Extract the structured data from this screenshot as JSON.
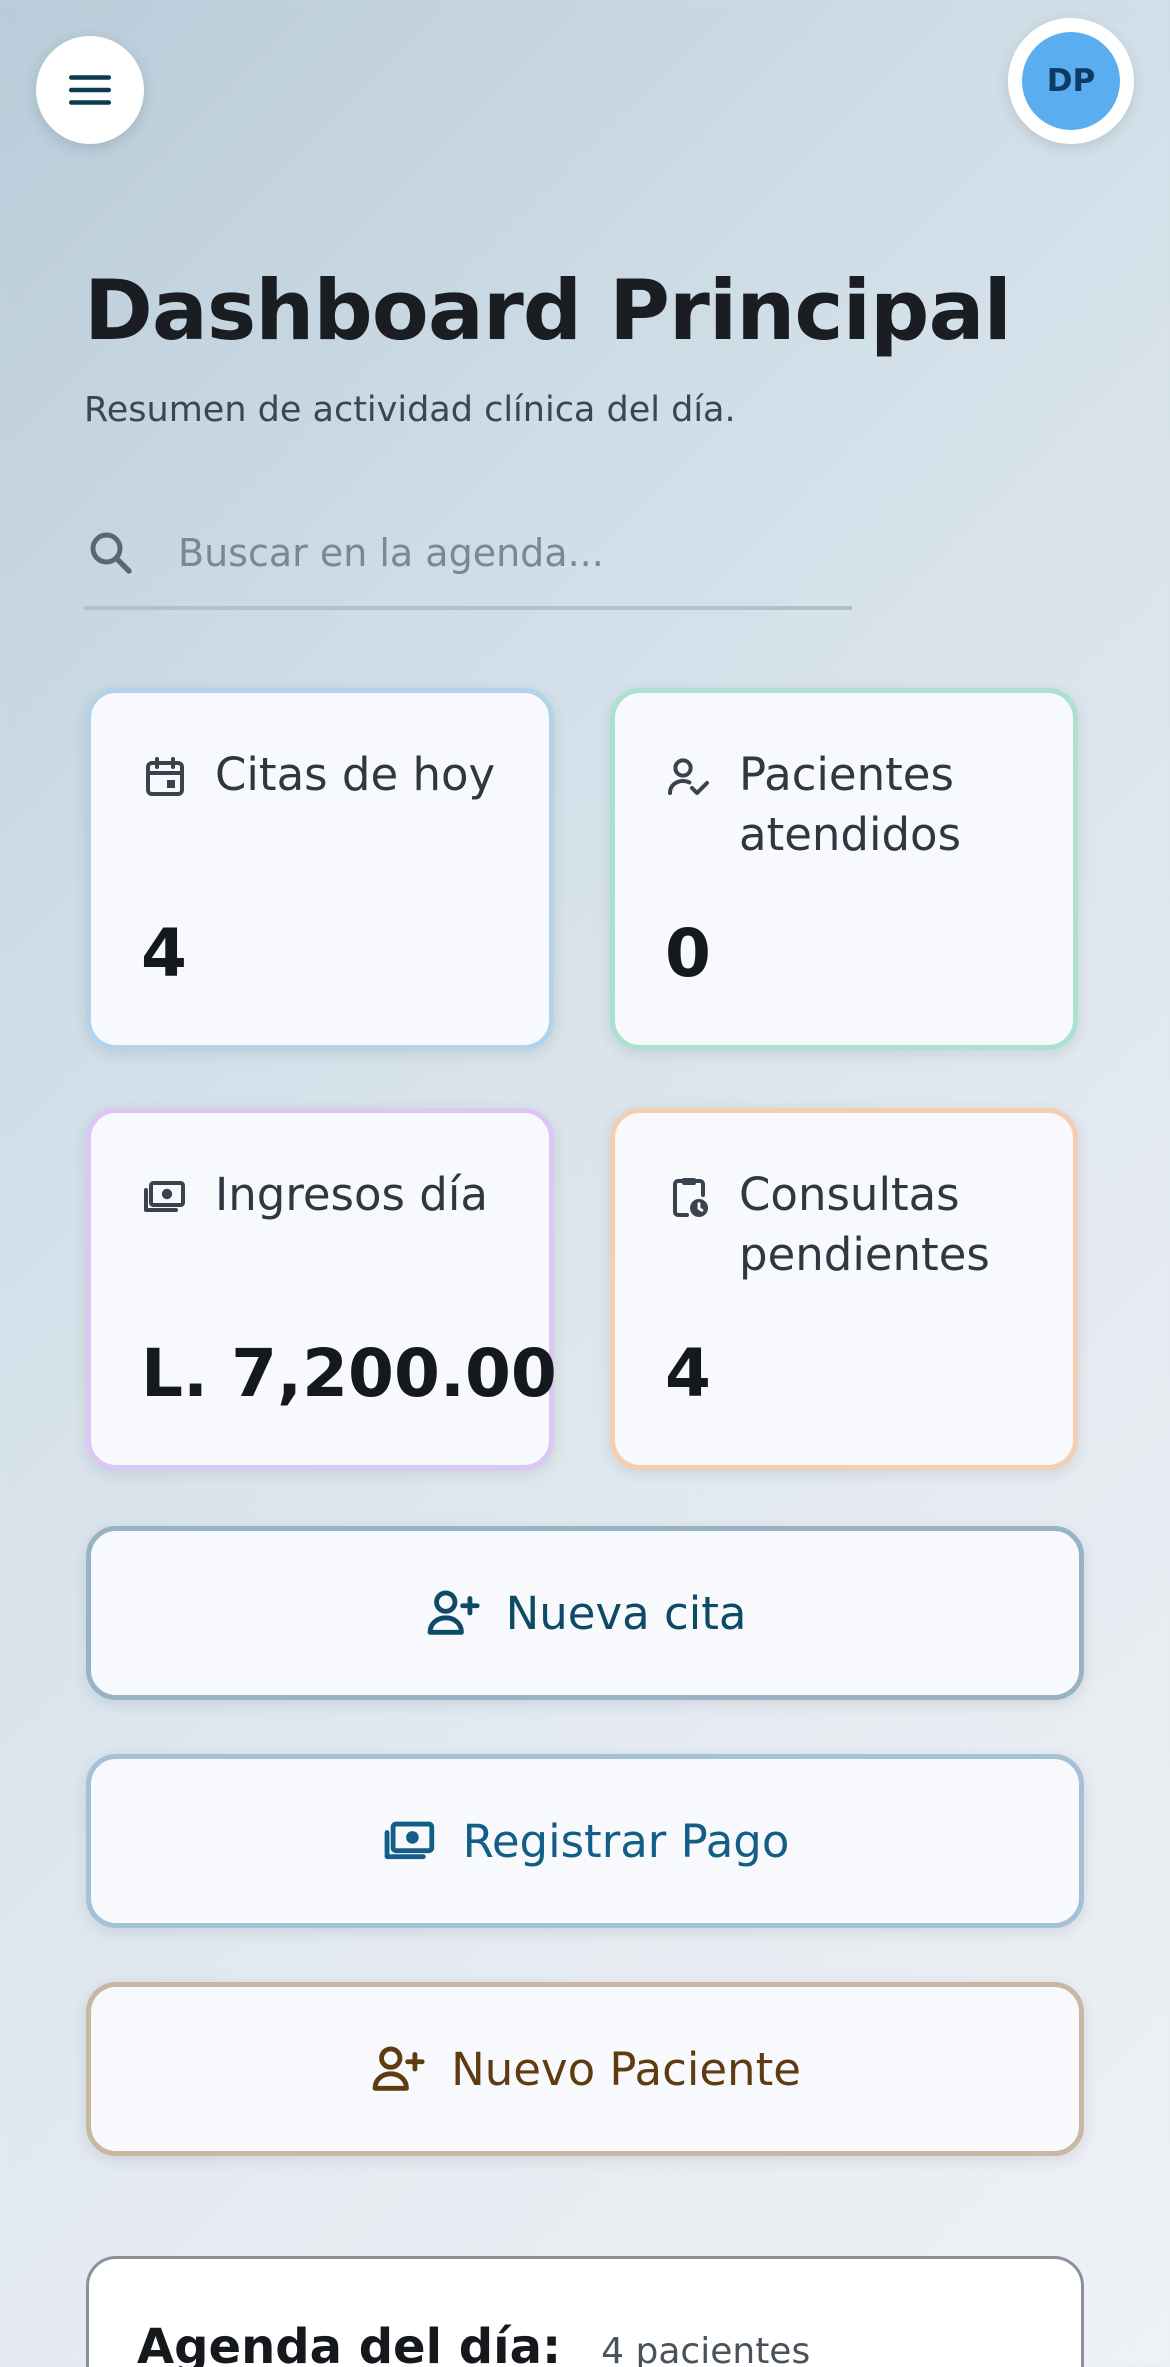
{
  "header": {
    "avatar_initials": "DP"
  },
  "page": {
    "title": "Dashboard Principal",
    "subtitle": "Resumen de actividad clínica del día."
  },
  "search": {
    "placeholder": "Buscar en la agenda..."
  },
  "stats": [
    {
      "label": "Citas de hoy",
      "value": "4",
      "icon": "calendar-icon",
      "accent": "#b3d3ea"
    },
    {
      "label": "Pacientes atendidos",
      "value": "0",
      "icon": "user-check-icon",
      "accent": "#abe1cf"
    },
    {
      "label": "Ingresos día",
      "value": "L. 7,200.00",
      "icon": "cash-icon",
      "accent": "#dcc6f4"
    },
    {
      "label": "Consultas pendientes",
      "value": "4",
      "icon": "clipboard-clock-icon",
      "accent": "#f5cdb1"
    }
  ],
  "actions": {
    "new_appointment": "Nueva cita",
    "register_payment": "Registrar Pago",
    "new_patient": "Nuevo Paciente"
  },
  "agenda": {
    "title": "Agenda del día:",
    "count": "4 pacientes"
  },
  "colors": {
    "avatar_bg": "#5aaef0",
    "primary_dark": "#0d4a66",
    "payment_blue": "#135e86",
    "patient_brown": "#5e3c10"
  }
}
